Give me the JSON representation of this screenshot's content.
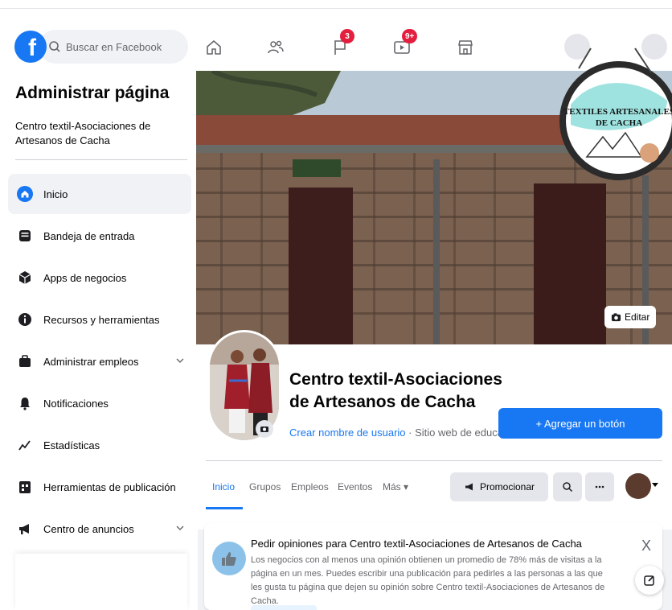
{
  "search": {
    "placeholder": "Buscar en Facebook"
  },
  "topnav": {
    "notifications_badge": "3",
    "watch_badge": "9+"
  },
  "sidebar": {
    "title": "Administrar página",
    "page_name": "Centro textil-Asociaciones de Artesanos de Cacha",
    "items": [
      {
        "label": "Inicio",
        "icon": "home-icon",
        "active": true
      },
      {
        "label": "Bandeja de entrada",
        "icon": "inbox-icon"
      },
      {
        "label": "Apps de negocios",
        "icon": "cube-icon"
      },
      {
        "label": "Recursos y herramientas",
        "icon": "info-icon"
      },
      {
        "label": "Administrar empleos",
        "icon": "briefcase-icon",
        "expandable": true
      },
      {
        "label": "Notificaciones",
        "icon": "bell-icon"
      },
      {
        "label": "Estadísticas",
        "icon": "chart-icon"
      },
      {
        "label": "Herramientas de publicación",
        "icon": "calendar-icon"
      },
      {
        "label": "Centro de anuncios",
        "icon": "megaphone-icon",
        "expandable": true
      }
    ]
  },
  "cover": {
    "edit_label": "Editar",
    "logo_line1": "TEXTILES ARTESANALES",
    "logo_line2": "DE CACHA"
  },
  "page": {
    "name": "Centro textil-Asociaciones de Artesanos de Cacha",
    "username_link": "Crear nombre de usuario",
    "category": " · Sitio web de educación",
    "add_button": "+ Agregar un botón"
  },
  "tabs": [
    "Inicio",
    "Grupos",
    "Empleos",
    "Eventos",
    "Más ▾"
  ],
  "actions": {
    "promote": "Promocionar"
  },
  "card": {
    "title": "Pedir opiniones para Centro textil-Asociaciones de Artesanos de Cacha",
    "body": "Los negocios con al menos una opinión obtienen un promedio de 78% más de visitas a la página en un mes. Puedes escribir una publicación para pedirles a las personas a las que les gusta tu página que dejen su opinión sobre Centro textil-Asociaciones de Artesanos de Cacha.",
    "close": "X"
  },
  "colors": {
    "brand": "#1877f2",
    "badge": "#e41e3f",
    "background": "#f0f2f5"
  }
}
